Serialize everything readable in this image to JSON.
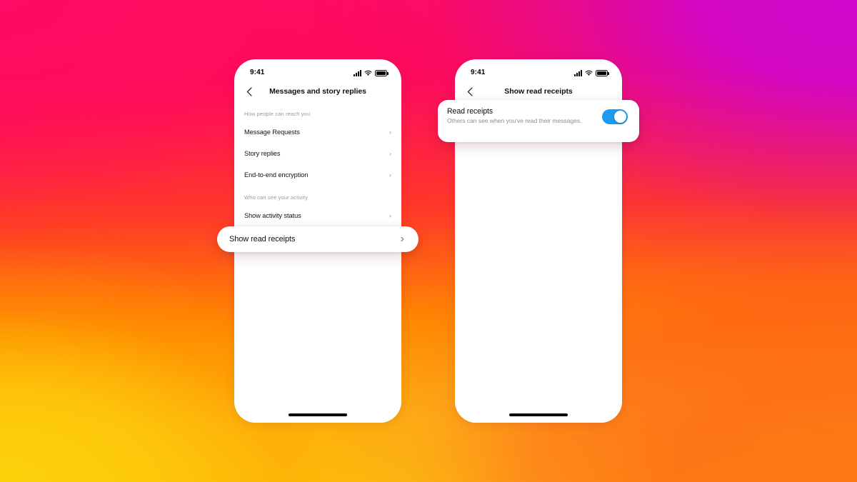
{
  "colors": {
    "toggle_on": "#1d9bf0",
    "gradient_top_left": "#ff0a64",
    "gradient_top_right": "#d008cc",
    "gradient_bottom_left": "#fcd20a",
    "gradient_bottom_right": "#ff7a14",
    "text_primary": "#0f0f0f",
    "text_secondary": "#9a9a9a"
  },
  "phones": [
    {
      "id": "left",
      "status_bar": {
        "time": "9:41",
        "signal_icon": "cellular-signal-icon",
        "wifi_icon": "wifi-icon",
        "battery_icon": "battery-full-icon"
      },
      "nav": {
        "back_icon": "chevron-left-icon",
        "title": "Messages and story replies"
      },
      "sections": [
        {
          "header": "How people can reach you",
          "rows": [
            {
              "label": "Message Requests",
              "chevron": "›"
            },
            {
              "label": "Story replies",
              "chevron": "›"
            },
            {
              "label": "End-to-end encryption",
              "chevron": "›"
            }
          ]
        },
        {
          "header": "Who can see your activity",
          "rows": [
            {
              "label": "Show activity status",
              "chevron": "›"
            }
          ]
        }
      ]
    },
    {
      "id": "right",
      "status_bar": {
        "time": "9:41",
        "signal_icon": "cellular-signal-icon",
        "wifi_icon": "wifi-icon",
        "battery_icon": "battery-full-icon"
      },
      "nav": {
        "back_icon": "chevron-left-icon",
        "title": "Show read receipts"
      },
      "sections": []
    }
  ],
  "callouts": {
    "read_receipts_row": {
      "label": "Show read receipts",
      "chevron": "›"
    },
    "read_receipts_toggle": {
      "title": "Read receipts",
      "subtitle": "Others can see when you've read their messages.",
      "toggle_state": "on"
    }
  }
}
